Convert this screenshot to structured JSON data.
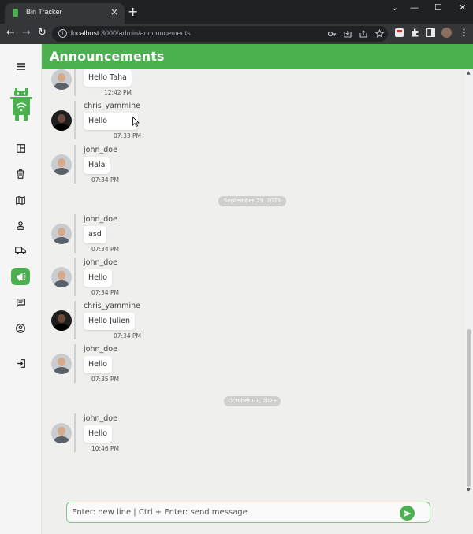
{
  "browser": {
    "tab_title": "Bin Tracker",
    "tab_close": "×",
    "new_tab": "+",
    "window_minimize": "—",
    "window_maximize": "☐",
    "window_close": "✕",
    "window_chevron": "⌄",
    "back": "←",
    "forward": "→",
    "reload": "↻",
    "url_host": "localhost",
    "url_path": ":3000/admin/announcements"
  },
  "header": {
    "title": "Announcements"
  },
  "sidebar": {
    "items": [
      {
        "name": "menu",
        "icon": "hamburger-icon"
      },
      {
        "name": "dashboard",
        "icon": "dashboard-icon"
      },
      {
        "name": "bins",
        "icon": "trash-icon"
      },
      {
        "name": "map",
        "icon": "map-icon"
      },
      {
        "name": "users",
        "icon": "person-icon"
      },
      {
        "name": "trucks",
        "icon": "truck-icon"
      },
      {
        "name": "announcements",
        "icon": "megaphone-icon",
        "active": true
      },
      {
        "name": "messages",
        "icon": "chat-icon"
      },
      {
        "name": "profile",
        "icon": "account-circle-icon"
      },
      {
        "name": "logout",
        "icon": "logout-icon"
      }
    ]
  },
  "messages": [
    {
      "user": "",
      "text": "Hello Taha",
      "time": "12:42 PM",
      "avatar": "light"
    },
    {
      "user": "chris_yammine",
      "text": "Hello",
      "time": "07:33 PM",
      "avatar": "dark"
    },
    {
      "user": "john_doe",
      "text": "Hala",
      "time": "07:34 PM",
      "avatar": "light"
    },
    {
      "user": "john_doe",
      "text": "asd",
      "time": "07:34 PM",
      "avatar": "light"
    },
    {
      "user": "john_doe",
      "text": "Hello",
      "time": "07:34 PM",
      "avatar": "light"
    },
    {
      "user": "chris_yammine",
      "text": "Hello Julien",
      "time": "07:34 PM",
      "avatar": "dark"
    },
    {
      "user": "john_doe",
      "text": "Hello",
      "time": "07:35 PM",
      "avatar": "light"
    },
    {
      "user": "john_doe",
      "text": "Hello",
      "time": "10:46 PM",
      "avatar": "light"
    }
  ],
  "date_separators": [
    "September 29, 2023",
    "October 01, 2023"
  ],
  "composer": {
    "placeholder": "Enter: new line | Ctrl + Enter: send message"
  },
  "colors": {
    "brand": "#4caf50",
    "background": "#efefee"
  }
}
